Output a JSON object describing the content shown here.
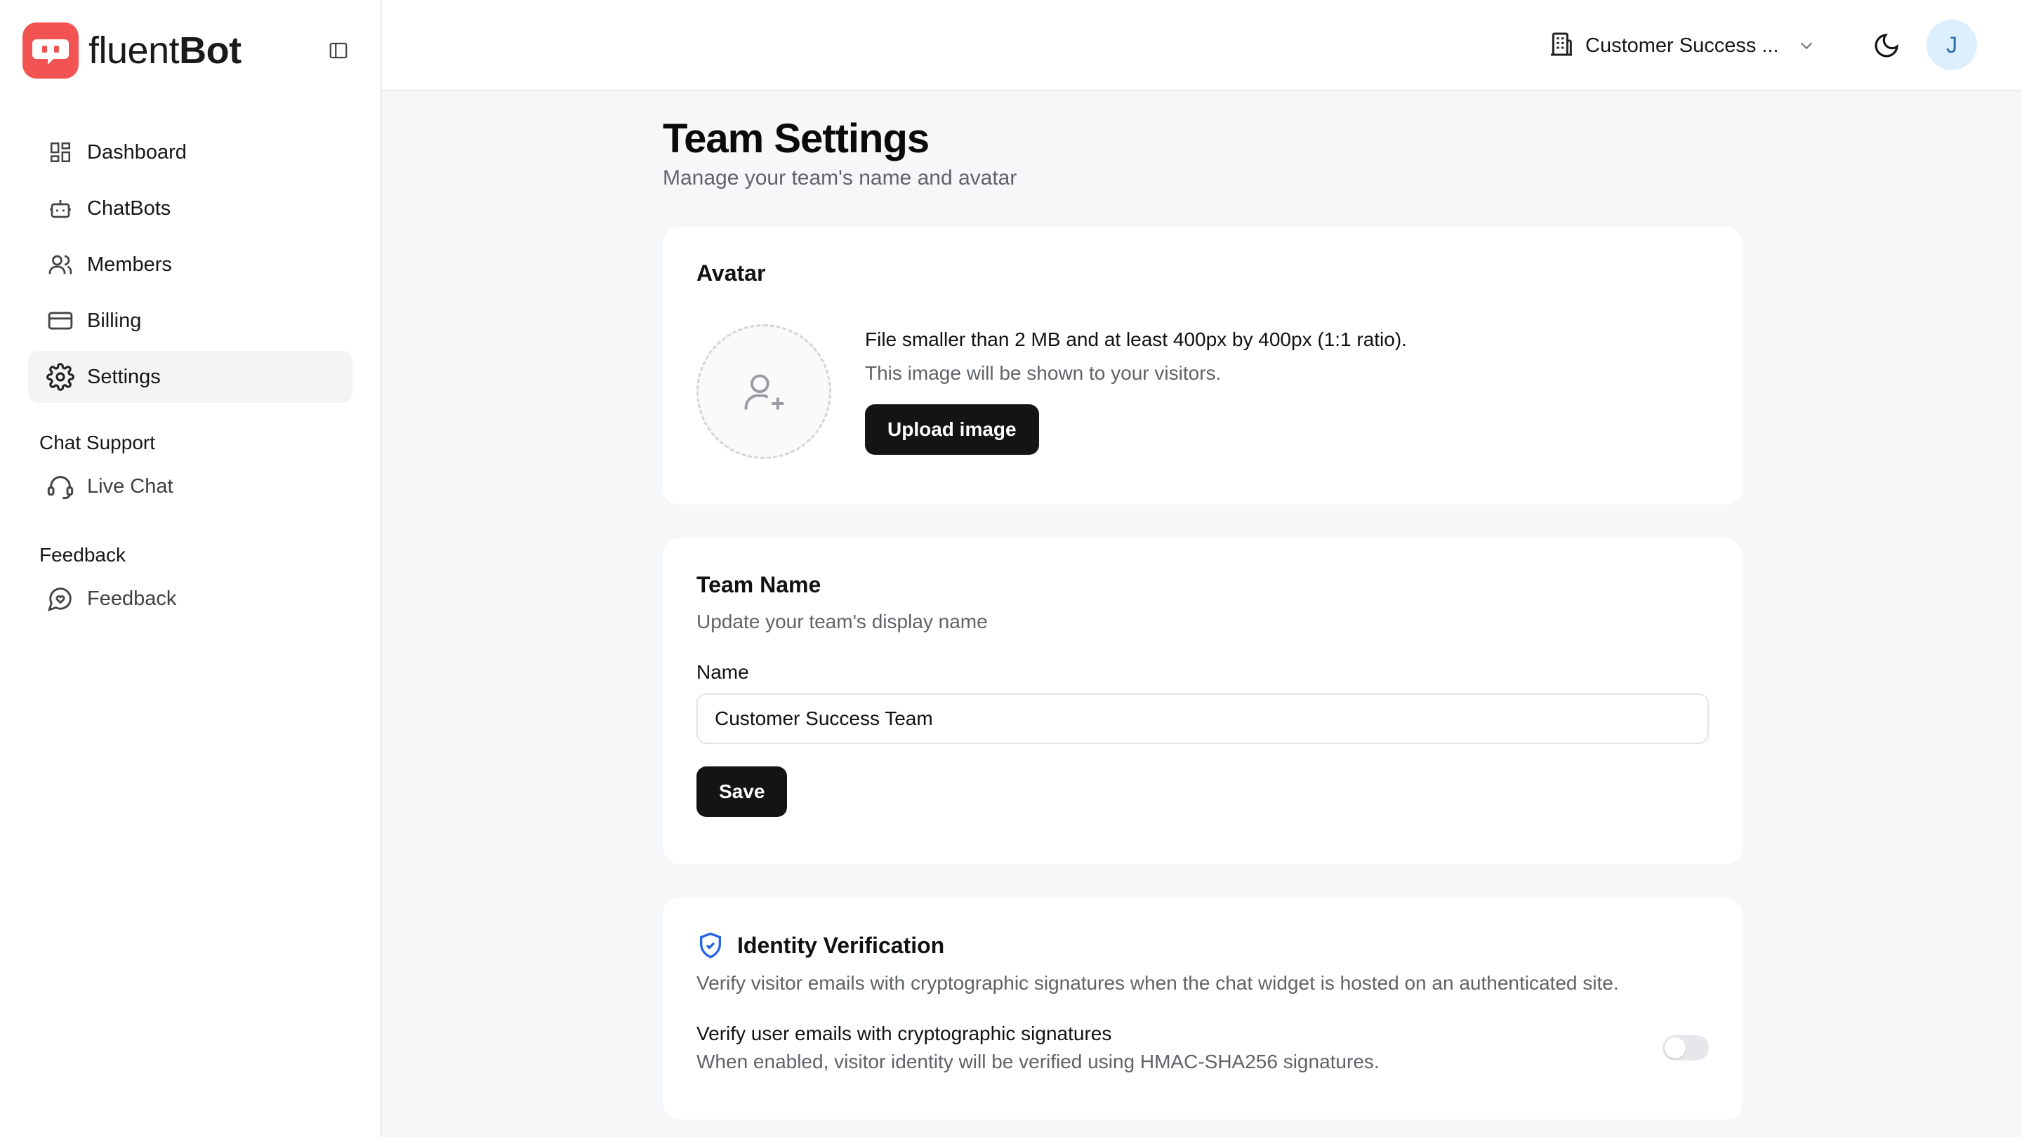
{
  "brand": {
    "name_light": "fluent",
    "name_bold": "Bot",
    "accent": "#f25454"
  },
  "sidebar": {
    "items": [
      {
        "label": "Dashboard",
        "icon": "dashboard-icon"
      },
      {
        "label": "ChatBots",
        "icon": "bot-icon"
      },
      {
        "label": "Members",
        "icon": "users-icon"
      },
      {
        "label": "Billing",
        "icon": "credit-card-icon"
      },
      {
        "label": "Settings",
        "icon": "gear-icon",
        "active": true
      }
    ],
    "sections": [
      {
        "title": "Chat Support",
        "items": [
          {
            "label": "Live Chat",
            "icon": "headset-icon"
          }
        ]
      },
      {
        "title": "Feedback",
        "items": [
          {
            "label": "Feedback",
            "icon": "message-heart-icon"
          }
        ]
      }
    ]
  },
  "header": {
    "team_label": "Customer Success ...",
    "avatar_initial": "J"
  },
  "page": {
    "title": "Team Settings",
    "subtitle": "Manage your team's name and avatar"
  },
  "avatar_card": {
    "title": "Avatar",
    "requirements": "File smaller than 2 MB and at least 400px by 400px (1:1 ratio).",
    "hint": "This image will be shown to your visitors.",
    "upload_label": "Upload image"
  },
  "team_name_card": {
    "title": "Team Name",
    "description": "Update your team's display name",
    "field_label": "Name",
    "field_value": "Customer Success Team",
    "save_label": "Save"
  },
  "identity_card": {
    "title": "Identity Verification",
    "description": "Verify visitor emails with cryptographic signatures when the chat widget is hosted on an authenticated site.",
    "toggle_label": "Verify user emails with cryptographic signatures",
    "toggle_description": "When enabled, visitor identity will be verified using HMAC-SHA256 signatures.",
    "toggle_enabled": false,
    "icon_color": "#2563eb"
  }
}
